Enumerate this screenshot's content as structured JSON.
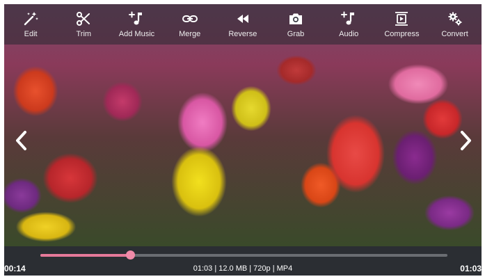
{
  "toolbar": {
    "items": [
      {
        "label": "Edit",
        "icon": "magic-wand-icon"
      },
      {
        "label": "Trim",
        "icon": "scissors-icon"
      },
      {
        "label": "Add Music",
        "icon": "music-add-icon"
      },
      {
        "label": "Merge",
        "icon": "link-icon"
      },
      {
        "label": "Reverse",
        "icon": "rewind-icon"
      },
      {
        "label": "Grab",
        "icon": "camera-icon"
      },
      {
        "label": "Audio",
        "icon": "music-note-icon"
      },
      {
        "label": "Compress",
        "icon": "compress-video-icon"
      },
      {
        "label": "Convert",
        "icon": "gears-icon"
      }
    ]
  },
  "navigation": {
    "prev_icon": "chevron-left-icon",
    "next_icon": "chevron-right-icon"
  },
  "player": {
    "current_time": "00:14",
    "total_time": "01:03",
    "info": "01:03 | 12.0 MB | 720p | MP4",
    "progress": 0.22,
    "accent_color": "#e6799a"
  }
}
